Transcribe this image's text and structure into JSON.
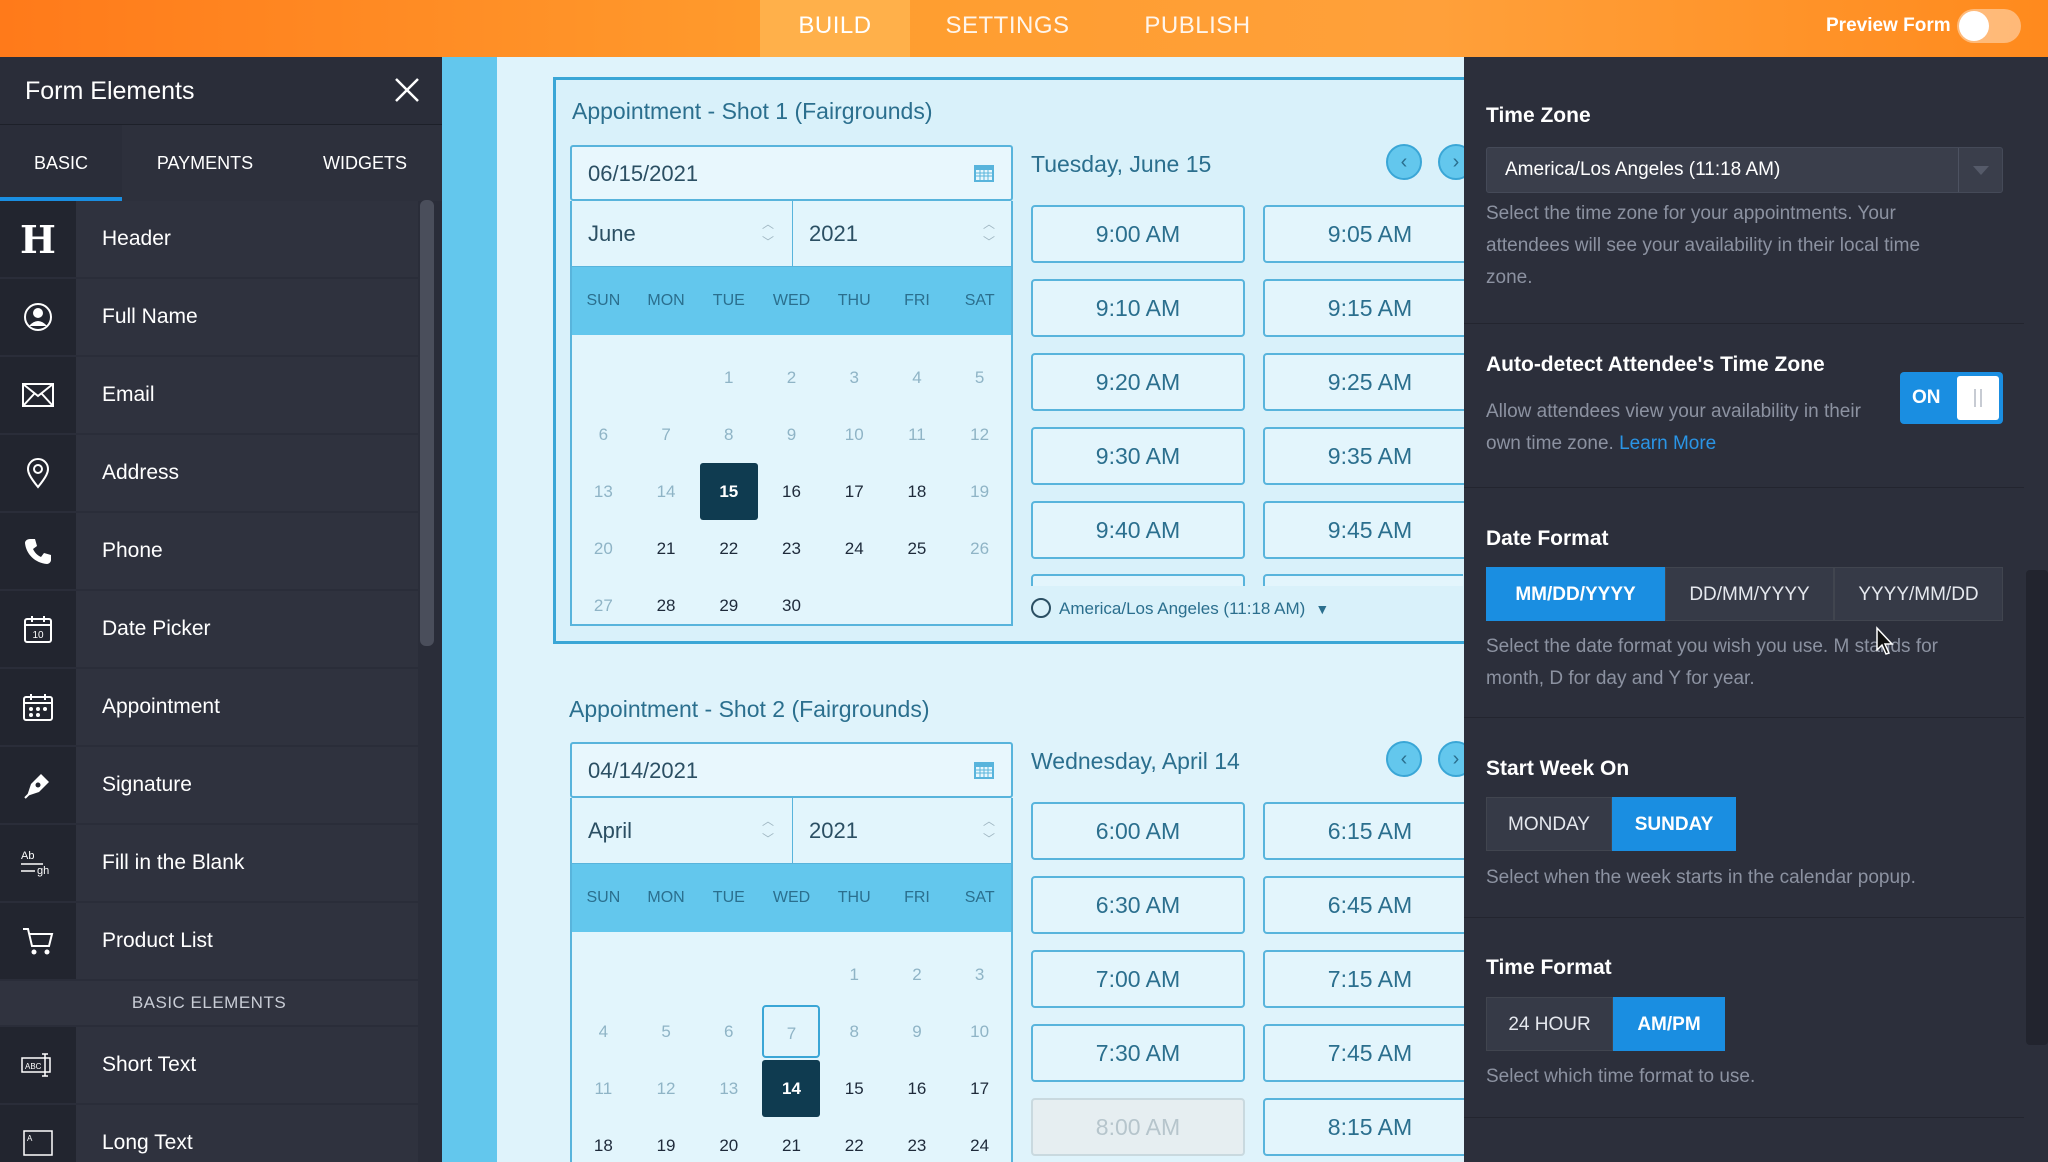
{
  "topbar": {
    "tabs": [
      "BUILD",
      "SETTINGS",
      "PUBLISH"
    ],
    "preview_label": "Preview Form"
  },
  "sidebar": {
    "title": "Form Elements",
    "tabs": [
      "BASIC",
      "PAYMENTS",
      "WIDGETS"
    ],
    "items": [
      {
        "label": "Header",
        "icon": "header-icon"
      },
      {
        "label": "Full Name",
        "icon": "user-icon"
      },
      {
        "label": "Email",
        "icon": "envelope-icon"
      },
      {
        "label": "Address",
        "icon": "map-pin-icon"
      },
      {
        "label": "Phone",
        "icon": "phone-icon"
      },
      {
        "label": "Date Picker",
        "icon": "calendar-icon"
      },
      {
        "label": "Appointment",
        "icon": "appointment-calendar-icon"
      },
      {
        "label": "Signature",
        "icon": "pen-icon"
      },
      {
        "label": "Fill in the Blank",
        "icon": "fill-blank-icon"
      },
      {
        "label": "Product List",
        "icon": "cart-icon"
      }
    ],
    "section_label": "BASIC ELEMENTS",
    "items2": [
      {
        "label": "Short Text",
        "icon": "short-text-icon"
      },
      {
        "label": "Long Text",
        "icon": "long-text-icon"
      }
    ]
  },
  "appointments": [
    {
      "title": "Appointment - Shot 1 (Fairgrounds)",
      "date_value": "06/15/2021",
      "month": "June",
      "year": "2021",
      "weekdays": [
        "SUN",
        "MON",
        "TUE",
        "WED",
        "THU",
        "FRI",
        "SAT"
      ],
      "day_title": "Tuesday, June 15",
      "slots": [
        "9:00 AM",
        "9:05 AM",
        "9:10 AM",
        "9:15 AM",
        "9:20 AM",
        "9:25 AM",
        "9:30 AM",
        "9:35 AM",
        "9:40 AM",
        "9:45 AM"
      ],
      "timezone_line": "America/Los Angeles (11:18 AM)"
    },
    {
      "title": "Appointment - Shot 2 (Fairgrounds)",
      "date_value": "04/14/2021",
      "month": "April",
      "year": "2021",
      "weekdays": [
        "SUN",
        "MON",
        "TUE",
        "WED",
        "THU",
        "FRI",
        "SAT"
      ],
      "day_title": "Wednesday, April 14",
      "slots": [
        "6:00 AM",
        "6:15 AM",
        "6:30 AM",
        "6:45 AM",
        "7:00 AM",
        "7:15 AM",
        "7:30 AM",
        "7:45 AM",
        "8:00 AM",
        "8:15 AM"
      ]
    }
  ],
  "panel": {
    "timezone": {
      "heading": "Time Zone",
      "value": "America/Los Angeles (11:18 AM)",
      "desc1": "Select the time zone for your appointments. Your",
      "desc2": "attendees will see your availability in their local time",
      "desc3": "zone."
    },
    "autodetect": {
      "heading": "Auto-detect Attendee's Time Zone",
      "desc1": "Allow attendees view your availability in their",
      "desc2": "own time zone.",
      "link": "Learn More",
      "toggle": "ON"
    },
    "dateformat": {
      "heading": "Date Format",
      "options": [
        "MM/DD/YYYY",
        "DD/MM/YYYY",
        "YYYY/MM/DD"
      ],
      "desc1": "Select the date format you wish you use. M stands for",
      "desc2": "month, D for day and Y for year."
    },
    "startweek": {
      "heading": "Start Week On",
      "options": [
        "MONDAY",
        "SUNDAY"
      ],
      "desc": "Select when the week starts in the calendar popup."
    },
    "timeformat": {
      "heading": "Time Format",
      "options": [
        "24 HOUR",
        "AM/PM"
      ],
      "desc": "Select which time format to use."
    }
  }
}
